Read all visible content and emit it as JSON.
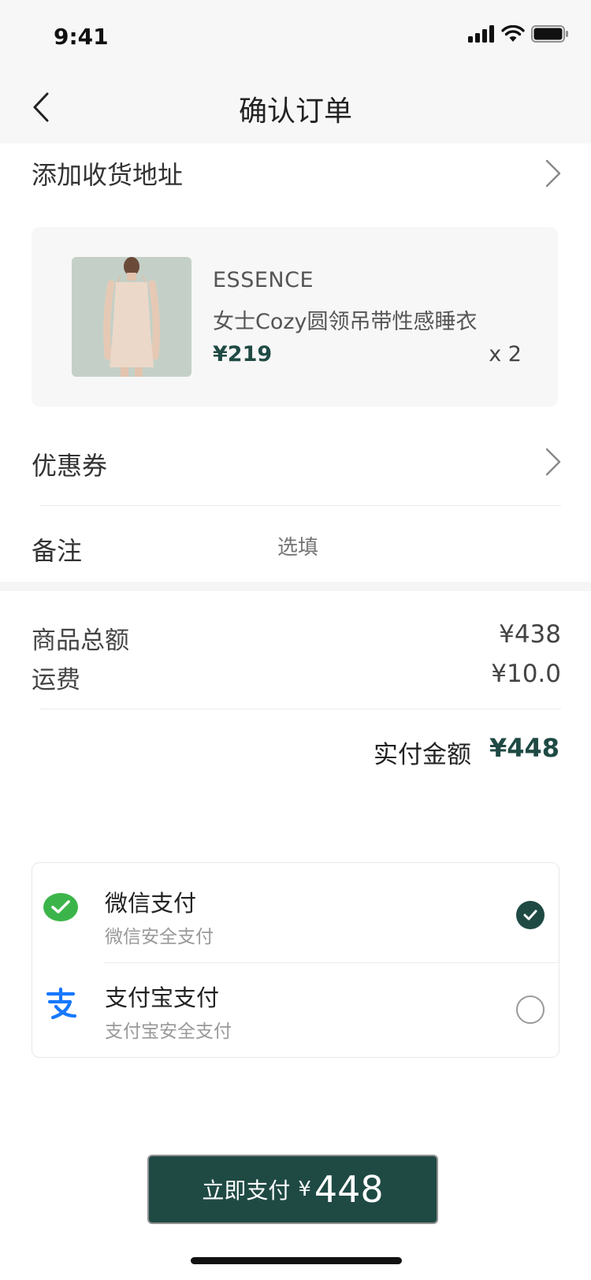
{
  "status_bar": {
    "time": "9:41"
  },
  "nav": {
    "title": "确认订单"
  },
  "address": {
    "label": "添加收货地址"
  },
  "product": {
    "brand": "ESSENCE",
    "name": "女士Cozy圆领吊带性感睡衣",
    "price": "¥219",
    "quantity": "x 2"
  },
  "coupon": {
    "label": "优惠券"
  },
  "remark": {
    "label": "备注",
    "placeholder": "选填"
  },
  "summary": {
    "goods_total_label": "商品总额",
    "goods_total_value": "¥438",
    "shipping_label": "运费",
    "shipping_value": "¥10.0",
    "paid_label": "实付金额",
    "paid_value": "¥448"
  },
  "payment": {
    "options": [
      {
        "title": "微信支付",
        "subtitle": "微信安全支付",
        "selected": true,
        "icon": "wechat-pay-icon"
      },
      {
        "title": "支付宝支付",
        "subtitle": "支付宝安全支付",
        "selected": false,
        "icon": "alipay-icon"
      }
    ]
  },
  "pay_button": {
    "label": "立即支付",
    "currency": "¥",
    "amount": "448"
  },
  "colors": {
    "accent": "#1f4a44",
    "wechat": "#3bb54a",
    "alipay": "#1678ff"
  }
}
